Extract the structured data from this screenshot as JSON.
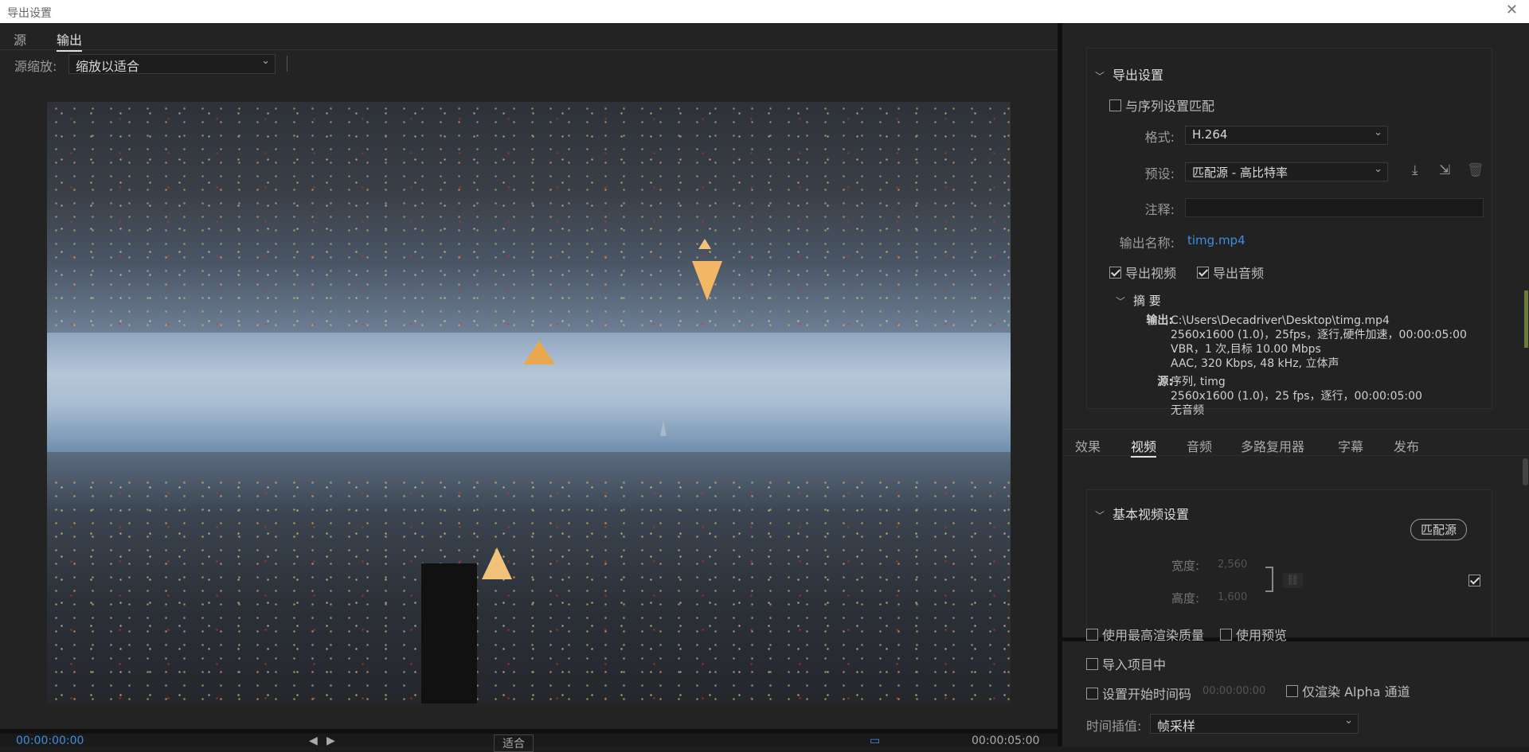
{
  "window": {
    "title": "导出设置",
    "close": "✕"
  },
  "left": {
    "tabs": [
      {
        "label": "源"
      },
      {
        "label": "输出"
      }
    ],
    "zoom_label": "源缩放:",
    "zoom_value": "缩放以适合",
    "timecode_start": "00:00:00:00",
    "fit_value": "适合",
    "timecode_end": "00:00:05:00"
  },
  "export": {
    "section_title": "导出设置",
    "match_sequence": {
      "label": "与序列设置匹配",
      "checked": false
    },
    "format_label": "格式:",
    "format_value": "H.264",
    "preset_label": "预设:",
    "preset_value": "匹配源 - 高比特率",
    "comment_label": "注释:",
    "comment_value": "",
    "output_name_label": "输出名称:",
    "output_name_value": "timg.mp4",
    "export_video": {
      "label": "导出视频",
      "checked": true
    },
    "export_audio": {
      "label": "导出音频",
      "checked": true
    },
    "summary": {
      "title": "摘 要",
      "output_label": "输出:",
      "output_lines": [
        "C:\\Users\\Decadriver\\Desktop\\timg.mp4",
        "2560x1600 (1.0)，25fps，逐行,硬件加速，00:00:05:00",
        "VBR，1 次,目标 10.00 Mbps",
        "AAC, 320 Kbps, 48  kHz, 立体声"
      ],
      "source_label": "源:",
      "source_lines": [
        "序列, timg",
        "2560x1600 (1.0)，25 fps，逐行，00:00:05:00",
        "无音频"
      ]
    }
  },
  "right_tabs": [
    {
      "label": "效果"
    },
    {
      "label": "视频"
    },
    {
      "label": "音频"
    },
    {
      "label": "多路复用器"
    },
    {
      "label": "字幕"
    },
    {
      "label": "发布"
    }
  ],
  "video": {
    "section_title": "基本视频设置",
    "match_source_button": "匹配源",
    "width_label": "宽度:",
    "width_value": "2,560",
    "height_label": "高度:",
    "height_value": "1,600"
  },
  "bottom": {
    "max_render": {
      "label": "使用最高渲染质量",
      "checked": false
    },
    "use_preview": {
      "label": "使用预览",
      "checked": false
    },
    "import_project": {
      "label": "导入项目中",
      "checked": false
    },
    "set_start_tc": {
      "label": "设置开始时间码",
      "checked": false
    },
    "start_tc_value": "00:00:00:00",
    "alpha_only": {
      "label": "仅渲染 Alpha 通道",
      "checked": false
    },
    "interp_label": "时间插值:",
    "interp_value": "帧采样"
  },
  "colors": {
    "accent_link": "#3c8ee0",
    "timecode": "#3c8ee0"
  }
}
